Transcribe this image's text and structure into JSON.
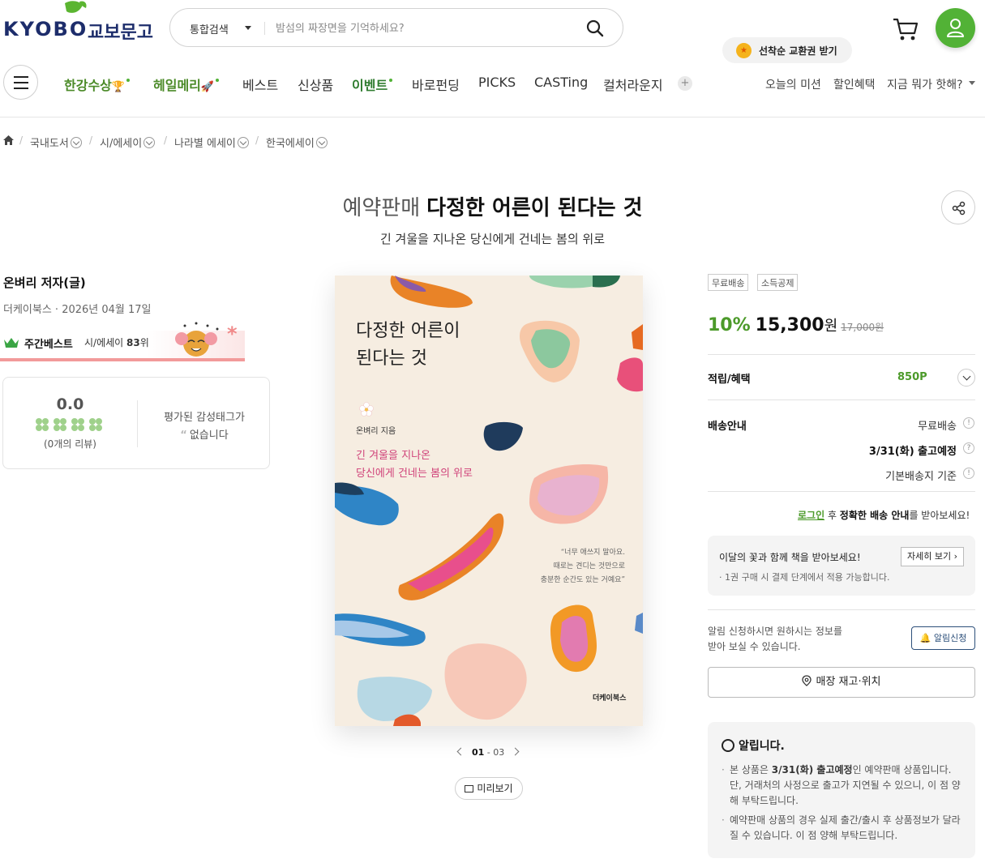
{
  "header": {
    "logo_en": "KYOBO",
    "logo_ko": "교보문고",
    "search_scope": "통합검색",
    "search_placeholder": "밤섬의 짜장면을 기억하세요?",
    "coupon_label": "선착순 교환권 받기"
  },
  "nav": {
    "items": [
      {
        "label": "한강수상",
        "emoji": "🏆"
      },
      {
        "label": "헤일메리",
        "emoji": "🚀"
      },
      {
        "label": "베스트"
      },
      {
        "label": "신상품"
      },
      {
        "label": "이벤트"
      },
      {
        "label": "바로펀딩"
      },
      {
        "label": "PICKS"
      },
      {
        "label": "CASTing"
      },
      {
        "label": "컬처라운지"
      }
    ],
    "right": [
      "오늘의 미션",
      "할인혜택",
      "지금 뭐가 핫해?"
    ]
  },
  "breadcrumb": [
    "국내도서",
    "시/에세이",
    "나라별 에세이",
    "한국에세이"
  ],
  "product": {
    "prefix": "예약판매",
    "title": "다정한 어른이 된다는 것",
    "subtitle": "긴 겨울을 지나온 당신에게 건네는 봄의 위로",
    "author": "온벼리 저자(글)",
    "publisher_date": "더케이북스 · 2026년 04월 17일"
  },
  "best": {
    "label": "주간베스트",
    "category": "시/에세이",
    "rank": "83",
    "rank_unit": "위"
  },
  "review": {
    "score": "0.0",
    "count": "(0개의 리뷰)",
    "emotion_line1": "평가된 감성태그가",
    "emotion_line2": "없습니다",
    "clover_color": "#9fd18b"
  },
  "cover": {
    "title": "다정한 어른이\n된다는 것",
    "author": "온벼리 지음",
    "sub1": "긴 겨울을 지나온",
    "sub2": "당신에게 건네는 봄의 위로",
    "quote": "“너무 애쓰지 말아요.\n때로는 견디는 것만으로\n충분한 순간도 있는 거예요”",
    "publisher": "더케이북스"
  },
  "pager": {
    "current": "01",
    "total": "03"
  },
  "preview_label": "미리보기",
  "pricing": {
    "tags": [
      "무료배송",
      "소득공제"
    ],
    "discount": "10%",
    "sale_price": "15,300",
    "won": "원",
    "original_price": "17,000원",
    "accent": "#4c9a2a"
  },
  "benefit": {
    "label": "적립/혜택",
    "points": "850P"
  },
  "shipping": {
    "label": "배송안내",
    "free": "무료배송",
    "date": "3/31(화) 출고예정",
    "basis": "기본배송지 기준"
  },
  "login_notice": {
    "link": "로그인",
    "mid": " 후 ",
    "bold": "정확한 배송 안내",
    "tail": "를 받아보세요!"
  },
  "flower": {
    "title": "이달의 꽃과 함께 책을 받아보세요!",
    "desc": "· 1권 구매 시 결제 단계에서 적용 가능합니다.",
    "more": "자세히 보기"
  },
  "alarm": {
    "line1": "알림 신청하시면 원하시는 정보를",
    "line2": "받아 보실 수 있습니다.",
    "button": "알림신청"
  },
  "store_button": "매장 재고·위치",
  "notice": {
    "title": "알립니다.",
    "item1_pre": "본 상품은 ",
    "item1_bold": "3/31(화) 출고예정",
    "item1_post": "인 예약판매 상품입니다. 단, 거래처의 사정으로 출고가 지연될 수 있으니, 이 점 양해 부탁드립니다.",
    "item2": "예약판매 상품의 경우 실제 출간/출시 후 상품정보가 달라질 수 있습니다. 이 점 양해 부탁드립니다."
  }
}
